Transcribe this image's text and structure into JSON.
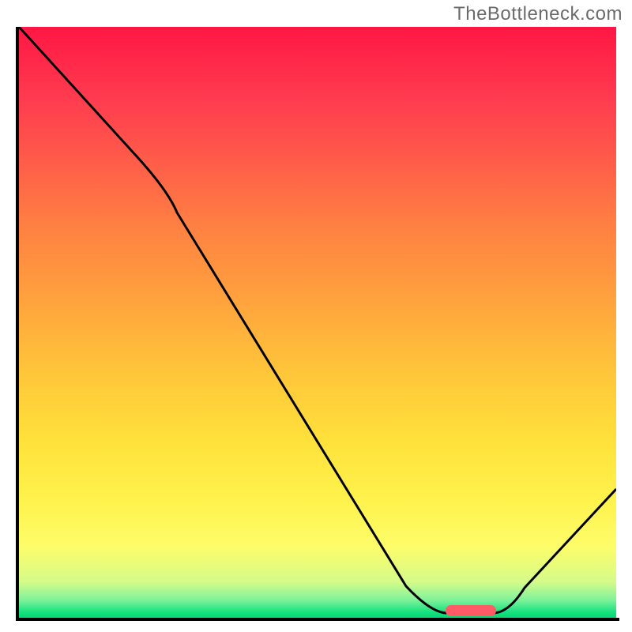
{
  "watermark": "TheBottleneck.com",
  "chart_data": {
    "type": "line",
    "x_range": [
      0,
      100
    ],
    "y_range": [
      0,
      100
    ],
    "title": "",
    "xlabel": "",
    "ylabel": "",
    "series": [
      {
        "name": "curve",
        "points": [
          {
            "x": 0,
            "y": 100
          },
          {
            "x": 20,
            "y": 78
          },
          {
            "x": 25,
            "y": 71
          },
          {
            "x": 65,
            "y": 5
          },
          {
            "x": 70,
            "y": 1
          },
          {
            "x": 80,
            "y": 1
          },
          {
            "x": 100,
            "y": 22
          }
        ]
      }
    ],
    "marker": {
      "x_start": 72,
      "x_end": 80,
      "y": 0.5,
      "color": "#ff5a66"
    },
    "gradient_stops": [
      {
        "pos": 0,
        "color": "#ff1744"
      },
      {
        "pos": 50,
        "color": "#ffc43a"
      },
      {
        "pos": 85,
        "color": "#fff24c"
      },
      {
        "pos": 100,
        "color": "#00d873"
      }
    ]
  }
}
